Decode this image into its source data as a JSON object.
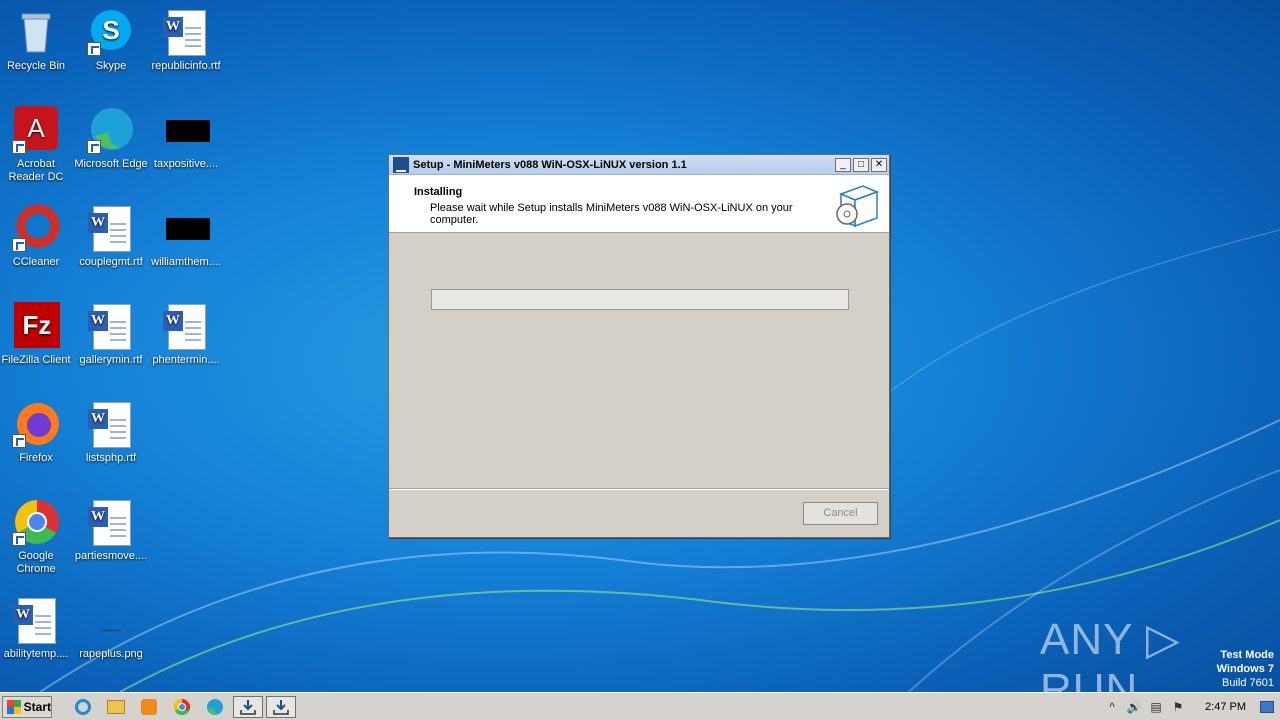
{
  "desktop": {
    "icons": [
      {
        "label": "Recycle Bin"
      },
      {
        "label": "Skype"
      },
      {
        "label": "republicinfo.rtf"
      },
      {
        "label": "Acrobat Reader DC"
      },
      {
        "label": "Microsoft Edge"
      },
      {
        "label": "taxpositive...."
      },
      {
        "label": "CCleaner"
      },
      {
        "label": "couplegmt.rtf"
      },
      {
        "label": "williamthem...."
      },
      {
        "label": "FileZilla Client"
      },
      {
        "label": "gallerymin.rtf"
      },
      {
        "label": "phentermin...."
      },
      {
        "label": "Firefox"
      },
      {
        "label": "listsphp.rtf"
      },
      {
        "label": "Google Chrome"
      },
      {
        "label": "partiesmove...."
      },
      {
        "label": "abilitytemp...."
      },
      {
        "label": "rapeplus.png"
      }
    ]
  },
  "dialog": {
    "title": "Setup - MiniMeters v088 WiN-OSX-LiNUX version 1.1",
    "minimize": "_",
    "maximize": "□",
    "close": "✕",
    "heading": "Installing",
    "subtext": "Please wait while Setup installs MiniMeters v088 WiN-OSX-LiNUX on your computer.",
    "progress_fraction": 0,
    "cancel_label": "Cancel"
  },
  "watermark": {
    "brand": "ANY ▷ RUN",
    "mode_line1": "Test Mode",
    "mode_line2": "Windows 7",
    "mode_line3": "Build 7601"
  },
  "taskbar": {
    "start_label": "Start",
    "pinned": [
      "ie-icon",
      "explorer-icon",
      "media-player-icon",
      "chrome-icon",
      "edge-icon",
      "installer-icon",
      "installer-icon"
    ],
    "clock": "2:47 PM"
  }
}
